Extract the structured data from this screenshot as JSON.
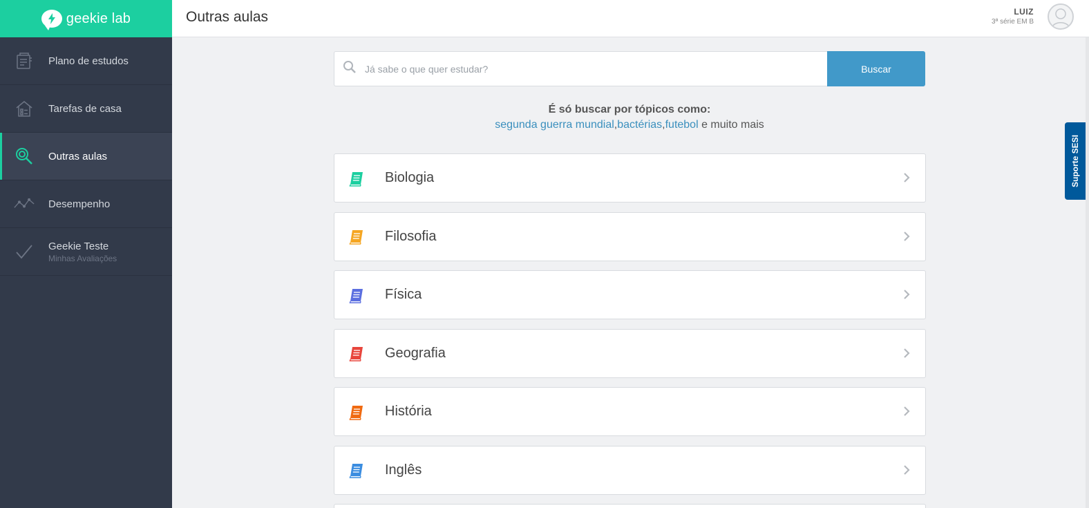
{
  "brand": {
    "name": "geekie lab",
    "color": "#1ccfa0"
  },
  "header": {
    "title": "Outras aulas",
    "user_name": "LUIZ",
    "user_class": "3ª série EM B"
  },
  "sidebar": {
    "items": [
      {
        "label": "Plano de estudos",
        "icon": "study-plan-icon"
      },
      {
        "label": "Tarefas de casa",
        "icon": "house-tasks-icon"
      },
      {
        "label": "Outras aulas",
        "icon": "search-icon",
        "active": true
      },
      {
        "label": "Desempenho",
        "icon": "chart-line-icon"
      },
      {
        "label": "Geekie Teste",
        "sublabel": "Minhas Avaliações",
        "icon": "checkmark-icon"
      }
    ]
  },
  "search": {
    "placeholder": "Já sabe o que quer estudar?",
    "button_label": "Buscar"
  },
  "hint": {
    "title": "É só buscar por tópicos como:",
    "links": [
      "segunda guerra mundial",
      "bactérias",
      "futebol"
    ],
    "separator": ",",
    "suffix": " e muito mais"
  },
  "subjects": [
    {
      "name": "Biologia",
      "color": "#1ccfa0"
    },
    {
      "name": "Filosofia",
      "color": "#f5a623"
    },
    {
      "name": "Física",
      "color": "#5b6fe0"
    },
    {
      "name": "Geografia",
      "color": "#e8453c"
    },
    {
      "name": "História",
      "color": "#f06a10"
    },
    {
      "name": "Inglês",
      "color": "#3b8de0"
    }
  ],
  "support": {
    "label": "Suporte SESI",
    "color": "#00599b"
  }
}
